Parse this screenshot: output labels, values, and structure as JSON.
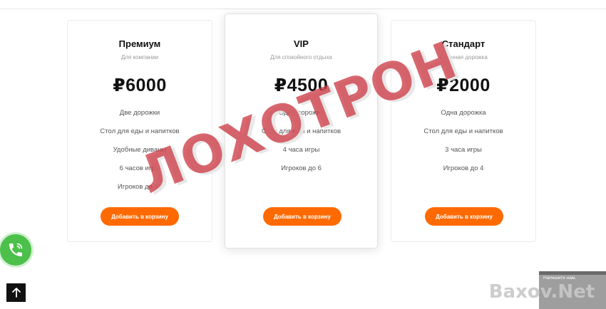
{
  "plans": [
    {
      "title": "Премиум",
      "subtitle": "Для компании",
      "price": "₽6000",
      "features": [
        "Две дорожки",
        "Стол для еды и напитков",
        "Удобные диваны",
        "6 часов игры",
        "Игроков до 12"
      ],
      "button_label": "Добавить в корзину"
    },
    {
      "title": "VIP",
      "subtitle": "Для спокойного отдыха",
      "price": "₽4500",
      "features": [
        "Одна дорожка",
        "Стол для еды и напитков",
        "4 часа игры",
        "Игроков до 6"
      ],
      "button_label": "Добавить в корзину"
    },
    {
      "title": "Стандарт",
      "subtitle": "Обычная дорожка",
      "price": "₽2000",
      "features": [
        "Одна дорожка",
        "Стол для еды и напитков",
        "3 часа игры",
        "Игроков до 4"
      ],
      "button_label": "Добавить в корзину"
    }
  ],
  "chat_widget": {
    "text": "Напишите нам,",
    "icon": "chat-icon"
  },
  "watermarks": {
    "stamp": "ЛОХОТРОН",
    "site": "Baxov.Net"
  },
  "icons": {
    "call": "phone-icon",
    "scroll_top": "arrow-up-icon"
  },
  "colors": {
    "accent": "#ff6a00",
    "call_button": "#4cc04a",
    "stamp": "#cd3c46",
    "scroll_top_bg": "#111111"
  }
}
